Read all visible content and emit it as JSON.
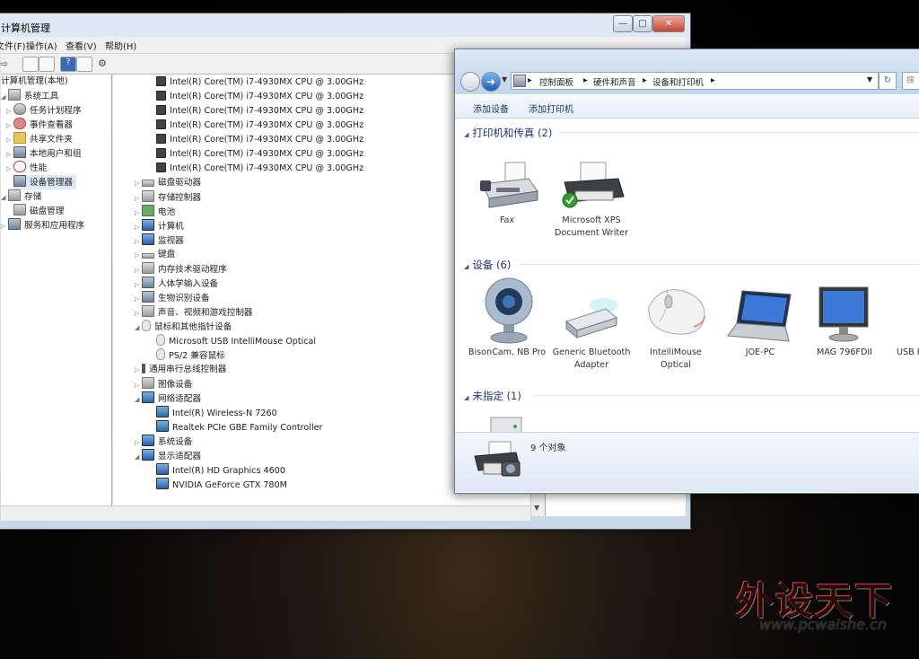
{
  "computer_management": {
    "title": "计算机管理",
    "menu": [
      "文件(F)",
      "操作(A)",
      "查看(V)",
      "帮助(H)"
    ],
    "tree": [
      {
        "label": "计算机管理(本地)"
      },
      {
        "label": "系统工具"
      },
      {
        "label": "任务计划程序"
      },
      {
        "label": "事件查看器"
      },
      {
        "label": "共享文件夹"
      },
      {
        "label": "本地用户和组"
      },
      {
        "label": "性能"
      },
      {
        "label": "设备管理器"
      },
      {
        "label": "存储"
      },
      {
        "label": "磁盘管理"
      },
      {
        "label": "服务和应用程序"
      }
    ],
    "devices": [
      "Intel(R) Core(TM) i7-4930MX CPU @ 3.00GHz",
      "Intel(R) Core(TM) i7-4930MX CPU @ 3.00GHz",
      "Intel(R) Core(TM) i7-4930MX CPU @ 3.00GHz",
      "Intel(R) Core(TM) i7-4930MX CPU @ 3.00GHz",
      "Intel(R) Core(TM) i7-4930MX CPU @ 3.00GHz",
      "Intel(R) Core(TM) i7-4930MX CPU @ 3.00GHz",
      "Intel(R) Core(TM) i7-4930MX CPU @ 3.00GHz",
      "磁盘驱动器",
      "存储控制器",
      "电池",
      "计算机",
      "监视器",
      "键盘",
      "内存技术驱动程序",
      "人体学输入设备",
      "生物识别设备",
      "声音、视频和游戏控制器",
      "鼠标和其他指针设备",
      "Microsoft USB IntelliMouse Optical",
      "PS/2 兼容鼠标",
      "通用串行总线控制器",
      "图像设备",
      "网络适配器",
      "Intel(R) Wireless-N 7260",
      "Realtek PCIe GBE Family Controller",
      "系统设备",
      "显示适配器",
      "Intel(R) HD Graphics 4600",
      "NVIDIA GeForce GTX 780M"
    ]
  },
  "devices_printers": {
    "breadcrumb": [
      "控制面板",
      "硬件和声音",
      "设备和打印机"
    ],
    "search_placeholder": "搜",
    "commands": [
      "添加设备",
      "添加打印机"
    ],
    "groups": {
      "printers": "打印机和传真 (2)",
      "devices": "设备 (6)",
      "unspecified": "未指定 (1)"
    },
    "printers": [
      "Fax",
      "Microsoft XPS Document Writer"
    ],
    "devices": [
      "BisonCam, NB Pro",
      "Generic Bluetooth Adapter",
      "IntelliMouse Optical",
      "JOE-PC",
      "MAG 796FDII",
      "USB K"
    ],
    "status": "9 个对象"
  },
  "watermark": {
    "cn": "外设天下",
    "url": "www.pcwaishe.cn"
  }
}
